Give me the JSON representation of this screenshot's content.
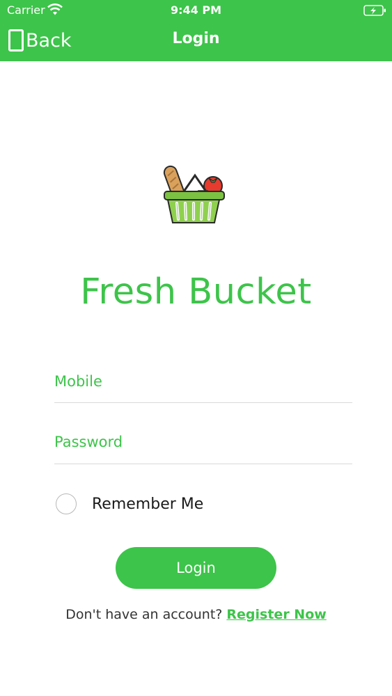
{
  "status_bar": {
    "carrier": "Carrier",
    "time": "9:44 PM"
  },
  "nav": {
    "back_label": "Back",
    "title": "Login"
  },
  "app": {
    "name": "Fresh Bucket"
  },
  "form": {
    "mobile_placeholder": "Mobile",
    "password_placeholder": "Password",
    "remember_label": "Remember Me",
    "remember_checked": false,
    "login_label": "Login"
  },
  "footer": {
    "prompt": "Don't have an account?",
    "register_label": "Register Now"
  },
  "colors": {
    "brand_green": "#3dc44a",
    "white": "#ffffff",
    "divider": "#d9d9d9"
  },
  "icons": [
    "wifi-icon",
    "battery-icon",
    "back-icon",
    "basket-logo-icon",
    "radio-icon"
  ]
}
